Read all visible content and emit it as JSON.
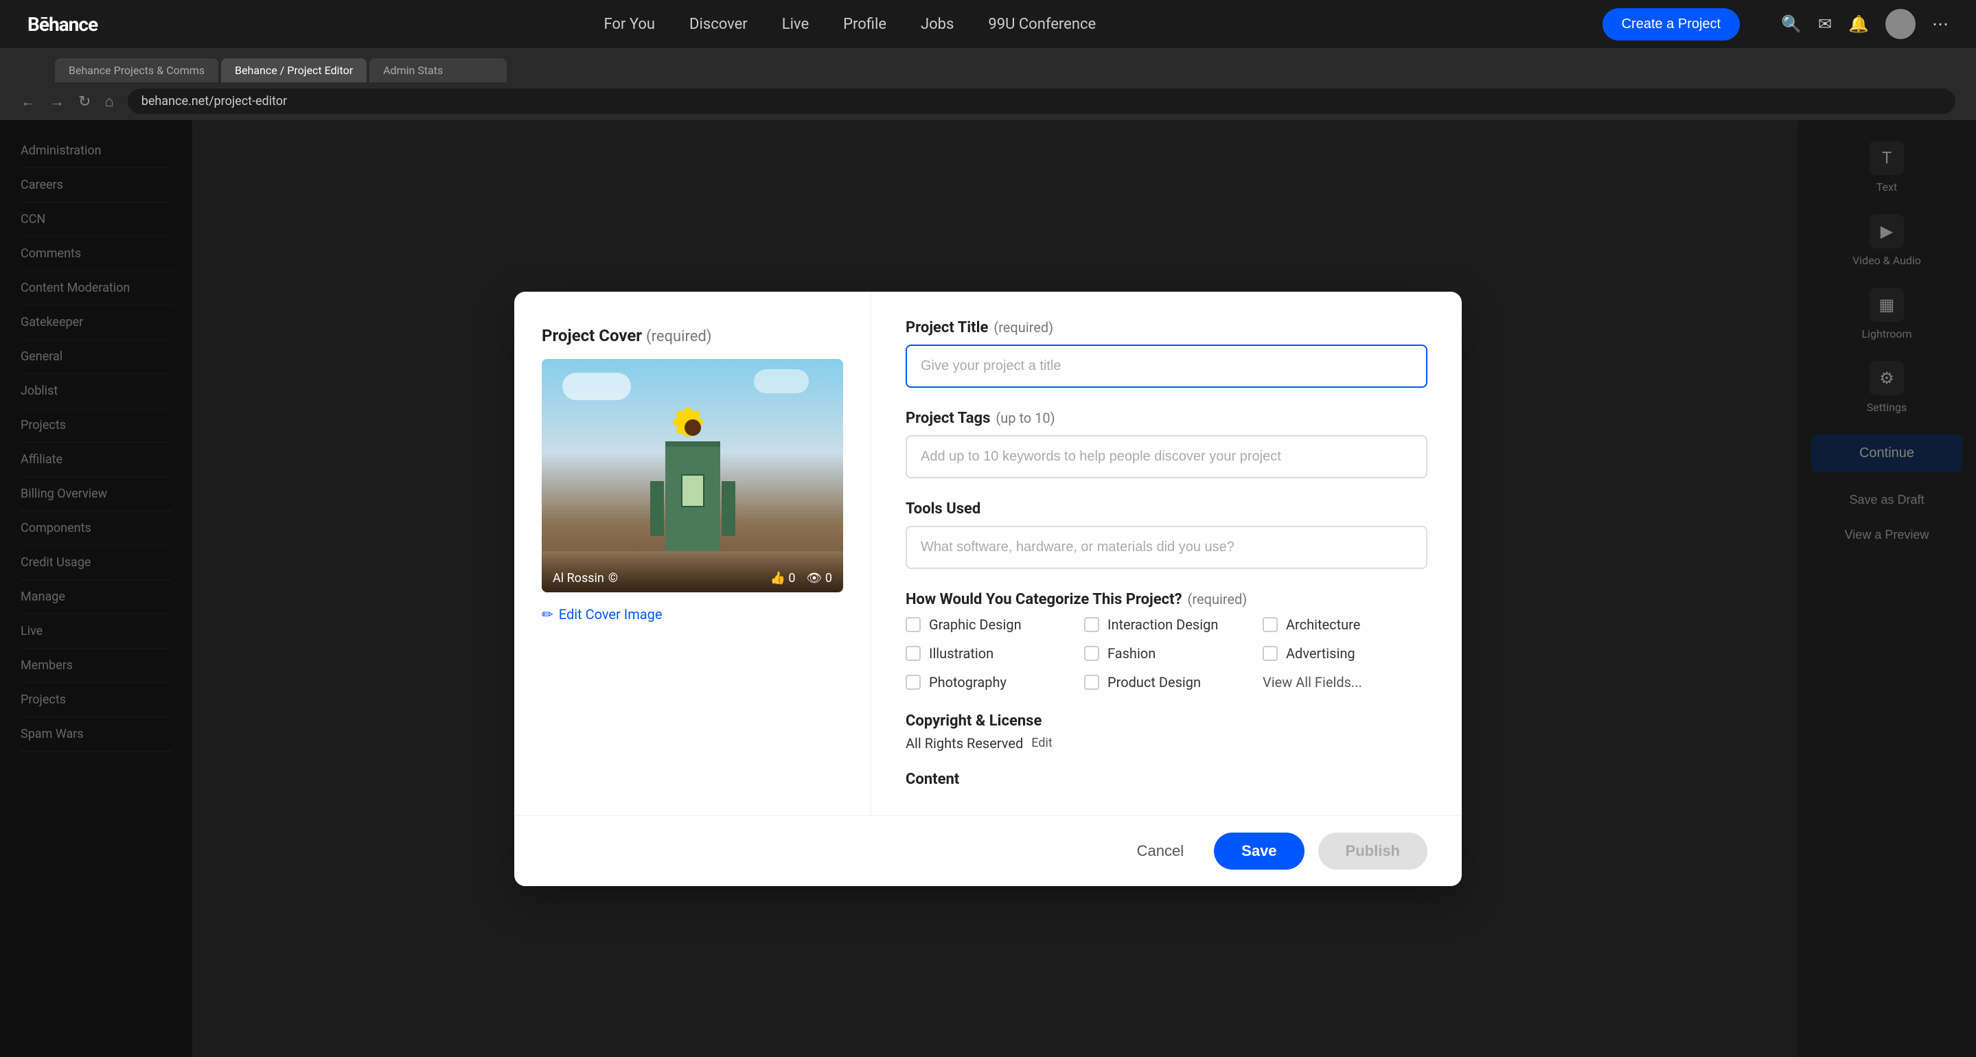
{
  "nav": {
    "logo": "Bēhance",
    "links": [
      "For You",
      "Discover",
      "Live",
      "Profile",
      "Jobs",
      "99U Conference"
    ],
    "create_button": "Create a Project"
  },
  "browser_tabs": [
    {
      "label": "Behance Projects & Comms",
      "active": false
    },
    {
      "label": "Behance / Project Editor",
      "active": true
    },
    {
      "label": "Admin Stats",
      "active": false
    }
  ],
  "sidebar": {
    "items": [
      "Administration",
      "Careers",
      "CCN",
      "Comments",
      "Content Moderation",
      "Gatekeeper",
      "General",
      "Joblist",
      "Projects",
      "Affiliate",
      "Billing Overview",
      "Components",
      "Credit Usage",
      "Manage",
      "Live",
      "Members",
      "Projects",
      "Spam Wars"
    ]
  },
  "right_sidebar": {
    "tools": [
      {
        "name": "Text",
        "icon": "T"
      },
      {
        "name": "Video & Audio",
        "icon": "▶"
      },
      {
        "name": "Lightroom",
        "icon": "▦"
      },
      {
        "name": "Settings",
        "icon": "⚙"
      }
    ],
    "continue_button": "Continue",
    "save_draft": "Save as Draft",
    "view_preview": "View a Preview"
  },
  "modal": {
    "cover_section": {
      "label": "Project Cover",
      "required_text": "(required)",
      "author": "Al Rossin",
      "likes": "0",
      "views": "0",
      "edit_link": "Edit Cover Image"
    },
    "form": {
      "title_label": "Project Title",
      "title_required": "(required)",
      "title_placeholder": "Give your project a title",
      "tags_label": "Project Tags",
      "tags_sub": "(up to 10)",
      "tags_placeholder": "Add up to 10 keywords to help people discover your project",
      "tools_label": "Tools Used",
      "tools_placeholder": "What software, hardware, or materials did you use?",
      "categorize_label": "How Would You Categorize This Project?",
      "categorize_required": "(required)",
      "categories": [
        {
          "col": 1,
          "items": [
            "Graphic Design",
            "Illustration",
            "Photography"
          ]
        },
        {
          "col": 2,
          "items": [
            "Interaction Design",
            "Fashion",
            "Product Design"
          ]
        },
        {
          "col": 3,
          "items": [
            "Architecture",
            "Advertising"
          ]
        }
      ],
      "view_all_label": "View All Fields...",
      "copyright_title": "Copyright & License",
      "copyright_value": "All Rights Reserved",
      "copyright_edit": "Edit",
      "content_label": "Content"
    },
    "footer": {
      "cancel": "Cancel",
      "save": "Save",
      "publish": "Publish"
    }
  }
}
